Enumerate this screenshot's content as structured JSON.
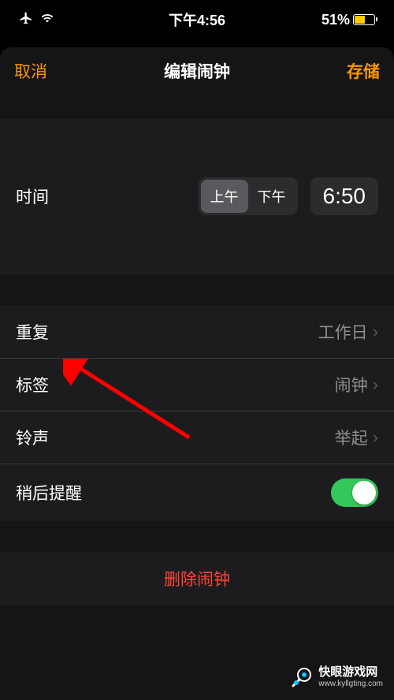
{
  "status_bar": {
    "time": "下午4:56",
    "battery": "51%"
  },
  "header": {
    "cancel": "取消",
    "title": "编辑闹钟",
    "save": "存储"
  },
  "time_section": {
    "label": "时间",
    "am": "上午",
    "pm": "下午",
    "value": "6:50"
  },
  "settings": {
    "repeat": {
      "label": "重复",
      "value": "工作日"
    },
    "tag": {
      "label": "标签",
      "value": "闹钟"
    },
    "sound": {
      "label": "铃声",
      "value": "举起"
    },
    "snooze": {
      "label": "稍后提醒"
    }
  },
  "delete": {
    "label": "删除闹钟"
  },
  "watermark": {
    "title": "快眼游戏网",
    "url": "www.kyllgting.com"
  }
}
